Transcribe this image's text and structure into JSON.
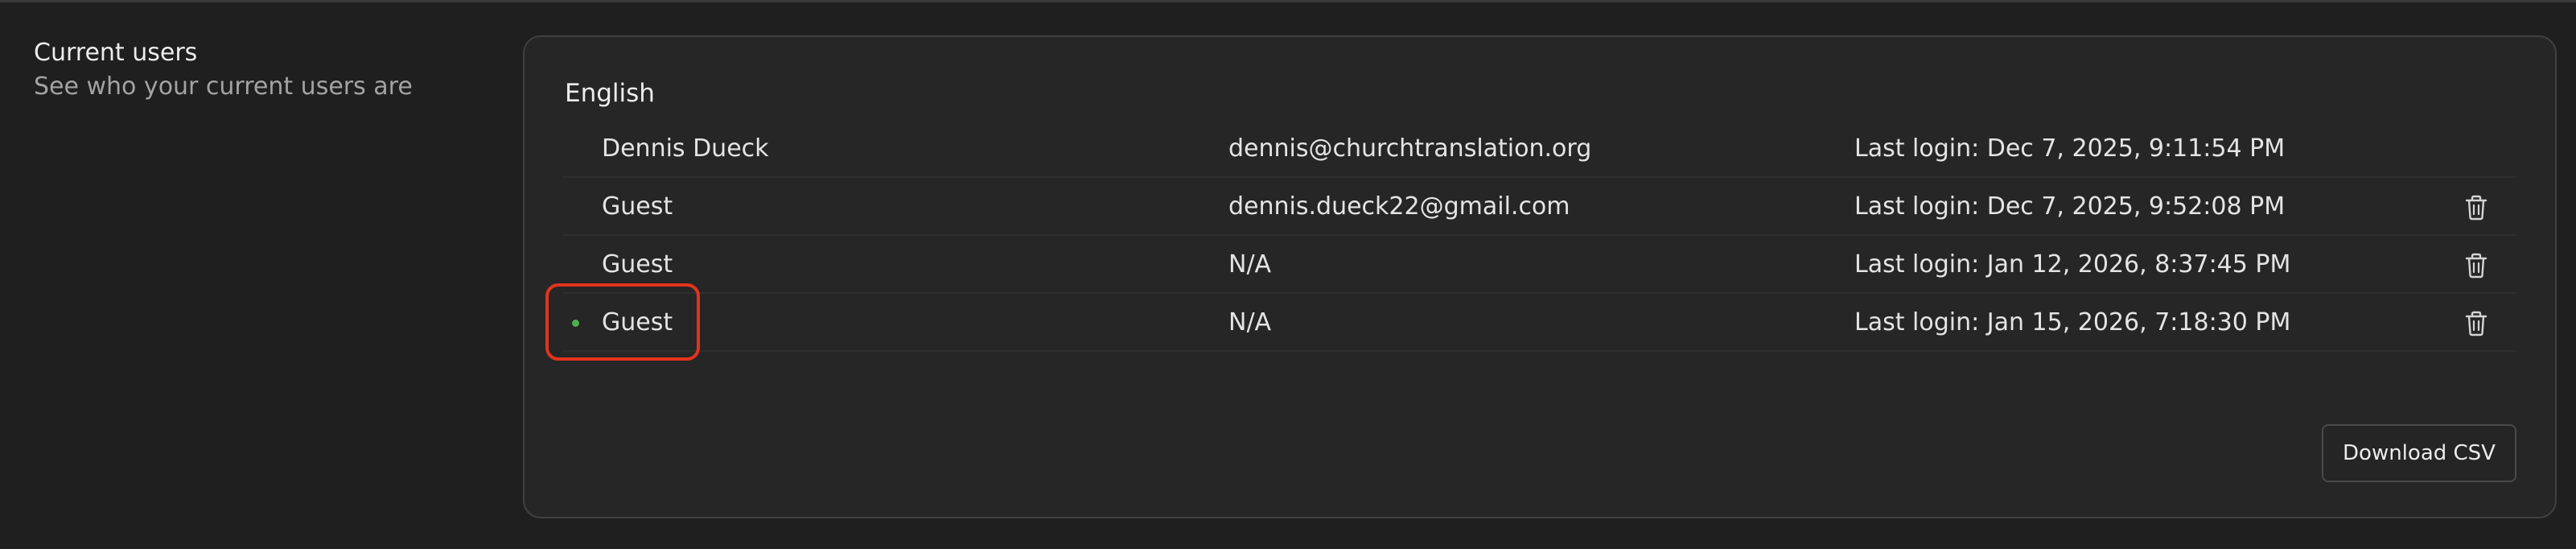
{
  "section": {
    "title": "Current users",
    "subtitle": "See who your current users are"
  },
  "group": {
    "label": "English",
    "users": [
      {
        "name": "Dennis Dueck",
        "email": "dennis@churchtranslation.org",
        "last_login": "Last login: Dec 7, 2025, 9:11:54 PM",
        "online": false,
        "deletable": false
      },
      {
        "name": "Guest",
        "email": "dennis.dueck22@gmail.com",
        "last_login": "Last login: Dec 7, 2025, 9:52:08 PM",
        "online": false,
        "deletable": true
      },
      {
        "name": "Guest",
        "email": "N/A",
        "last_login": "Last login: Jan 12, 2026, 8:37:45 PM",
        "online": false,
        "deletable": true
      },
      {
        "name": "Guest",
        "email": "N/A",
        "last_login": "Last login: Jan 15, 2026, 7:18:30 PM",
        "online": true,
        "deletable": true
      }
    ]
  },
  "actions": {
    "download_csv_label": "Download CSV"
  },
  "icons": {
    "delete": "trash-icon",
    "online": "online-status-dot"
  },
  "colors": {
    "background": "#1f1f1f",
    "card": "#262626",
    "online": "#4caf50",
    "highlight": "#e2341d"
  }
}
